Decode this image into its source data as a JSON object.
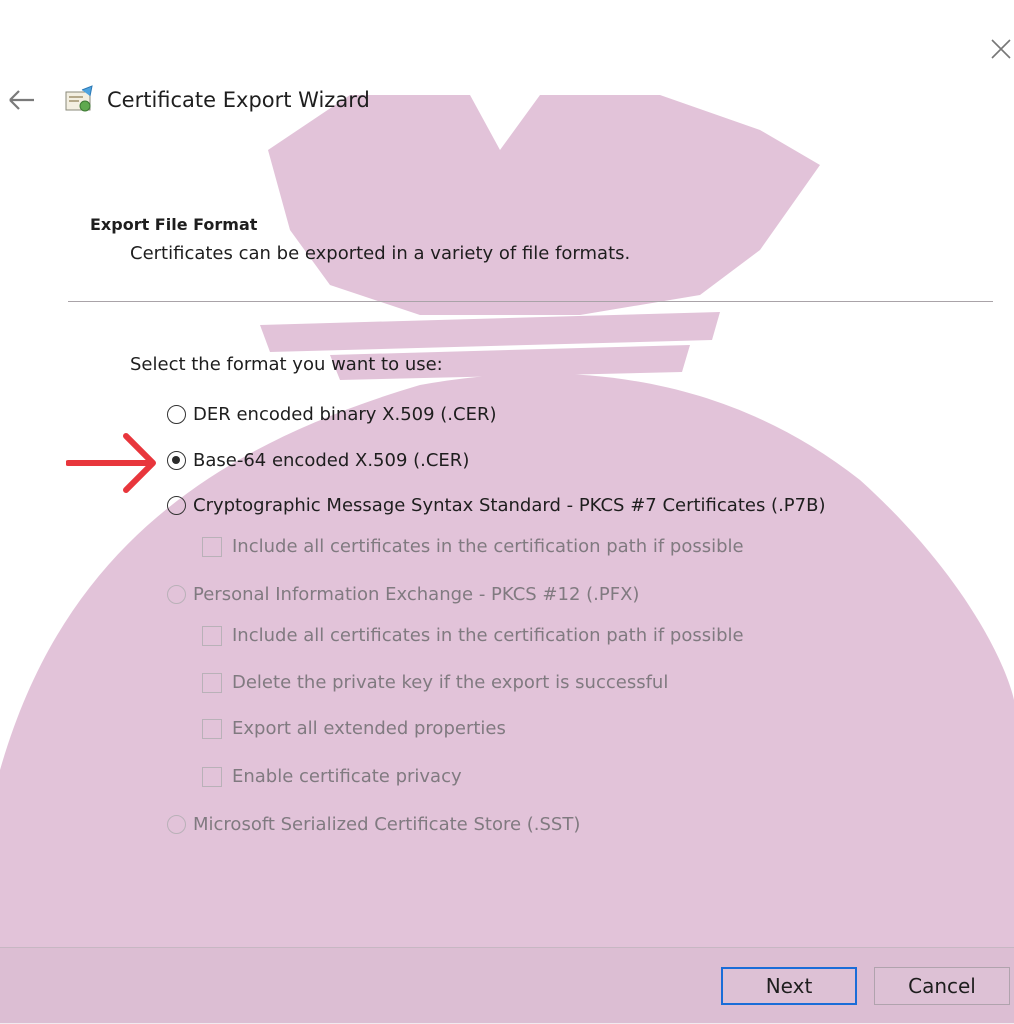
{
  "colors": {
    "watermark": "#e2c3d9",
    "arrow": "#e8363c",
    "focus_border": "#1a6dd8",
    "disabled_text": "#807a80"
  },
  "header": {
    "back_icon": "back-arrow-icon",
    "wizard_icon": "certificate-icon",
    "close_icon": "close-icon",
    "title": "Certificate Export Wizard"
  },
  "section": {
    "title": "Export File Format",
    "description": "Certificates can be exported in a variety of file formats."
  },
  "prompt": "Select the format you want to use:",
  "options": {
    "der": {
      "label": "DER encoded binary X.509 (.CER)",
      "checked": false,
      "enabled": true
    },
    "base64": {
      "label": "Base-64 encoded X.509 (.CER)",
      "checked": true,
      "enabled": true
    },
    "pkcs7": {
      "label": "Cryptographic Message Syntax Standard - PKCS #7 Certificates (.P7B)",
      "checked": false,
      "enabled": true
    },
    "pkcs7_include": {
      "label": "Include all certificates in the certification path if possible",
      "checked": false,
      "enabled": false
    },
    "pfx": {
      "label": "Personal Information Exchange - PKCS #12 (.PFX)",
      "checked": false,
      "enabled": false
    },
    "pfx_include": {
      "label": "Include all certificates in the certification path if possible",
      "checked": false,
      "enabled": false
    },
    "pfx_delete_key": {
      "label": "Delete the private key if the export is successful",
      "checked": false,
      "enabled": false
    },
    "pfx_export_props": {
      "label": "Export all extended properties",
      "checked": false,
      "enabled": false
    },
    "pfx_privacy": {
      "label": "Enable certificate privacy",
      "checked": false,
      "enabled": false
    },
    "sst": {
      "label": "Microsoft Serialized Certificate Store (.SST)",
      "checked": false,
      "enabled": false
    }
  },
  "buttons": {
    "next": "Next",
    "cancel": "Cancel"
  }
}
